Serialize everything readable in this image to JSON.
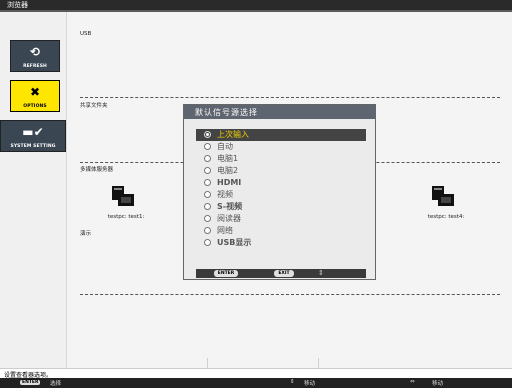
{
  "title": "浏览器",
  "nav": [
    {
      "label": "REFRESH",
      "icon": "refresh-icon"
    },
    {
      "label": "OPTIONS",
      "icon": "tools-icon"
    },
    {
      "label": "SYSTEM SETTING",
      "icon": "system-icon"
    }
  ],
  "sections": {
    "usb": "USB",
    "shared": "共享文件夹",
    "media": "多媒体服务器",
    "display": "演示"
  },
  "devices": [
    "testpc: test1:",
    "testpc: test4:"
  ],
  "dialog": {
    "title": "默认信号源选择",
    "options": [
      "上次输入",
      "自动",
      "电脑1",
      "电脑2",
      "HDMI",
      "视频",
      "S-视频",
      "阅读器",
      "网络",
      "USB显示"
    ],
    "selected_index": 0,
    "enter_label": "ENTER",
    "exit_label": "EXIT",
    "updown": "⇕"
  },
  "status": "设置查看器选项。",
  "footer": {
    "enter_key": "ENTER",
    "enter_text": "选择",
    "move_text": "移动",
    "move_text2": "移动"
  },
  "colors": {
    "accent": "#ffe600",
    "selected_text": "#f0d000"
  }
}
